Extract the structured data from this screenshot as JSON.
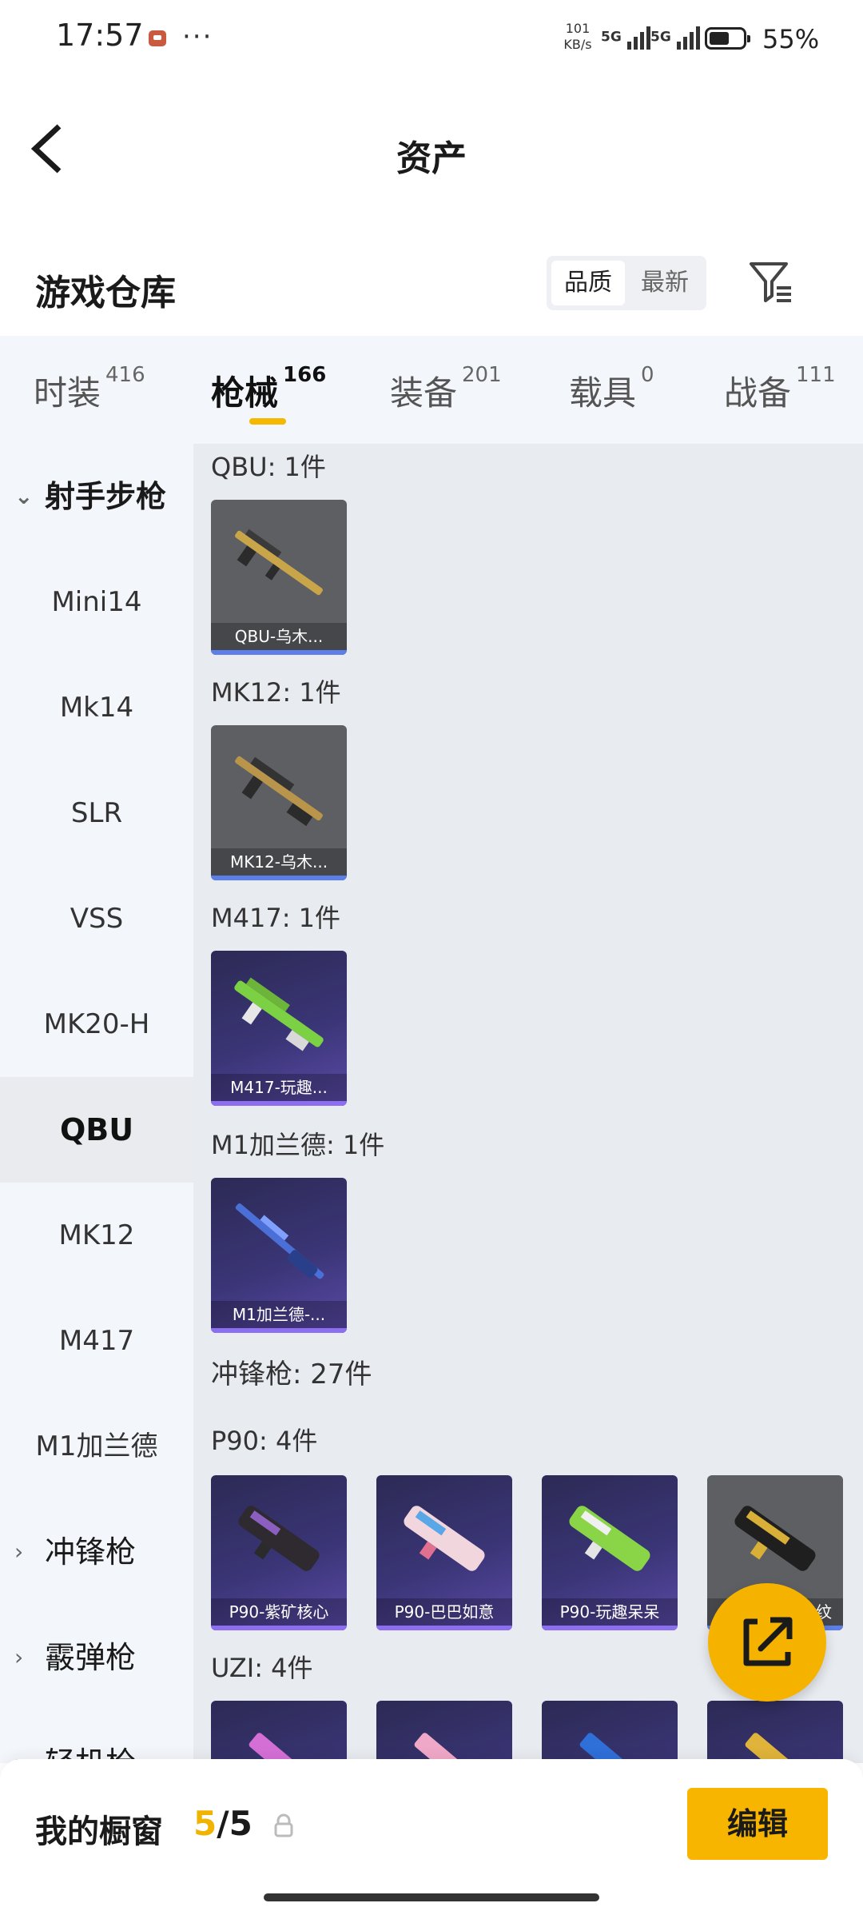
{
  "status_bar": {
    "time": "17:57",
    "dots": "···",
    "net_speed_value": "101",
    "net_speed_unit": "KB/s",
    "signal1": "5G",
    "signal2": "5G",
    "battery": "55%"
  },
  "header": {
    "title": "资产"
  },
  "warehouse": {
    "title": "游戏仓库",
    "sort_options": [
      "品质",
      "最新"
    ],
    "sort_selected": "品质"
  },
  "tabs": [
    {
      "label": "时装",
      "count": "416"
    },
    {
      "label": "枪械",
      "count": "166",
      "active": true
    },
    {
      "label": "装备",
      "count": "201"
    },
    {
      "label": "载具",
      "count": "0"
    },
    {
      "label": "战备",
      "count": "111"
    }
  ],
  "sidebar": {
    "items": [
      {
        "label": "射手步枪",
        "type": "group-expanded"
      },
      {
        "label": "Mini14"
      },
      {
        "label": "Mk14"
      },
      {
        "label": "SLR"
      },
      {
        "label": "VSS"
      },
      {
        "label": "MK20-H"
      },
      {
        "label": "QBU",
        "selected": true
      },
      {
        "label": "MK12"
      },
      {
        "label": "M417"
      },
      {
        "label": "M1加兰德"
      },
      {
        "label": "冲锋枪",
        "type": "group-collapsed"
      },
      {
        "label": "霰弹枪",
        "type": "group-collapsed"
      },
      {
        "label": "轻机枪",
        "type": "group-collapsed"
      }
    ]
  },
  "main": {
    "sections": [
      {
        "heading": "QBU: 1件",
        "cards": [
          {
            "label": "QBU-乌木...",
            "style": "gray"
          }
        ]
      },
      {
        "heading": "MK12: 1件",
        "cards": [
          {
            "label": "MK12-乌木...",
            "style": "gray"
          }
        ]
      },
      {
        "heading": "M417: 1件",
        "cards": [
          {
            "label": "M417-玩趣...",
            "style": "purple"
          }
        ]
      },
      {
        "heading": "M1加兰德: 1件",
        "cards": [
          {
            "label": "M1加兰德-...",
            "style": "purple"
          }
        ]
      }
    ],
    "category_heading": "冲锋枪: 27件",
    "p90": {
      "heading": "P90: 4件",
      "cards": [
        {
          "label": "P90-紫矿核心",
          "style": "purple"
        },
        {
          "label": "P90-巴巴如意",
          "style": "purple"
        },
        {
          "label": "P90-玩趣呆呆",
          "style": "purple"
        },
        {
          "label": "纹",
          "style": "gray"
        }
      ]
    },
    "uzi": {
      "heading": "UZI: 4件"
    }
  },
  "bottom": {
    "label": "我的橱窗",
    "count_current": "5",
    "count_separator": "/",
    "count_total": "5",
    "edit_label": "编辑"
  },
  "colors": {
    "accent": "#f5b800",
    "card_gray": "#5e5f63",
    "card_purple": "#3a3576"
  },
  "icons": {
    "back": "back-chevron-icon",
    "filter": "filter-icon",
    "fab": "share-external-icon",
    "lock": "lock-icon"
  }
}
